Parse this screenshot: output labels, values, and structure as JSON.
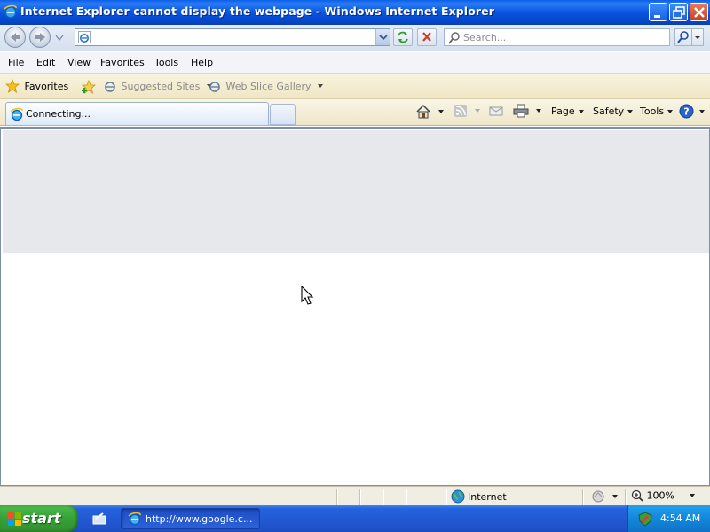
{
  "window": {
    "title": "Internet Explorer cannot display the webpage - Windows Internet Explorer"
  },
  "address_bar": {
    "url": "",
    "search_placeholder": "Search..."
  },
  "menu": {
    "items": [
      "File",
      "Edit",
      "View",
      "Favorites",
      "Tools",
      "Help"
    ]
  },
  "favorites_bar": {
    "favorites_label": "Favorites",
    "suggested_sites": "Suggested Sites",
    "web_slice_gallery": "Web Slice Gallery"
  },
  "tab": {
    "label": "Connecting..."
  },
  "command_bar": {
    "page_label": "Page",
    "safety_label": "Safety",
    "tools_label": "Tools"
  },
  "status_bar": {
    "zone": "Internet",
    "zoom": "100%"
  },
  "taskbar": {
    "start_label": "start",
    "task_label": "http://www.google.c...",
    "clock": "4:54 AM"
  },
  "colors": {
    "titlebar": "#0854e0",
    "taskbar": "#2257d1",
    "start": "#38a338"
  }
}
